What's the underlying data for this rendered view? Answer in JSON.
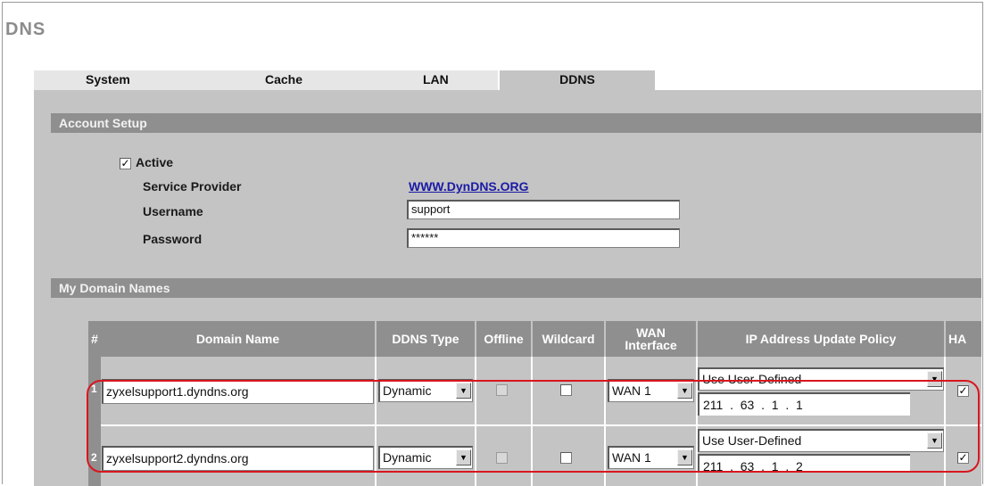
{
  "page": {
    "title": "DNS"
  },
  "tabs": [
    {
      "label": "System"
    },
    {
      "label": "Cache"
    },
    {
      "label": "LAN"
    },
    {
      "label": "DDNS",
      "active": true
    }
  ],
  "account": {
    "section_title": "Account Setup",
    "active_label": "Active",
    "active_checked": "✓",
    "service_provider_label": "Service Provider",
    "service_provider_value": "WWW.DynDNS.ORG",
    "username_label": "Username",
    "username_value": "support",
    "password_label": "Password",
    "password_value": "******"
  },
  "domains": {
    "section_title": "My Domain Names",
    "headers": {
      "num": "#",
      "domain_name": "Domain Name",
      "ddns_type": "DDNS Type",
      "offline": "Offline",
      "wildcard": "Wildcard",
      "wan_interface": "WAN Interface",
      "ip_policy": "IP Address Update Policy",
      "ha": "HA"
    },
    "rows": [
      {
        "num": "1",
        "domain": "zyxelsupport1.dyndns.org",
        "ddns_type": "Dynamic",
        "wan": "WAN 1",
        "ip_policy": "Use User-Defined",
        "ip_address": "211  .  63  .  1  .  1",
        "ha_checked": "✓"
      },
      {
        "num": "2",
        "domain": "zyxelsupport2.dyndns.org",
        "ddns_type": "Dynamic",
        "wan": "WAN 1",
        "ip_policy": "Use User-Defined",
        "ip_address": "211  .  63  .  1  .  2",
        "ha_checked": "✓"
      }
    ]
  },
  "icons": {
    "dropdown": "▼"
  },
  "colors": {
    "panel": "#c4c4c4",
    "section_bar": "#8f8f8f",
    "link": "#1a1aa6",
    "highlight": "#d9161f"
  }
}
